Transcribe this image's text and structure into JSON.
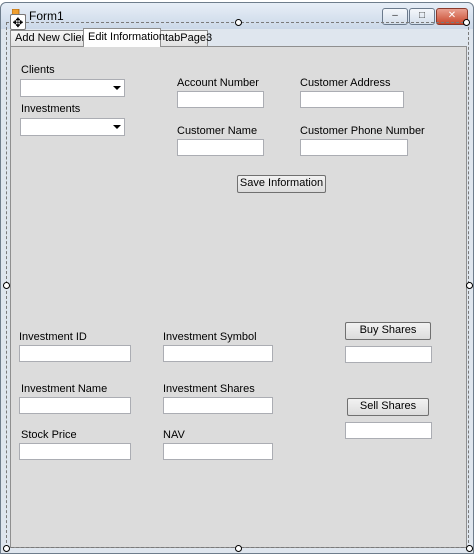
{
  "window": {
    "title": "Form1",
    "minimize_glyph": "–",
    "maximize_glyph": "□",
    "close_glyph": "✕"
  },
  "tabs": [
    {
      "label": "Add New Client"
    },
    {
      "label": "Edit Information"
    },
    {
      "label": "tabPage3"
    }
  ],
  "edit_info": {
    "clients_label": "Clients",
    "clients_value": "",
    "investments_label": "Investments",
    "investments_value": "",
    "account_number_label": "Account Number",
    "account_number_value": "",
    "customer_address_label": "Customer Address",
    "customer_address_value": "",
    "customer_name_label": "Customer Name",
    "customer_name_value": "",
    "customer_phone_label": "Customer Phone Number",
    "customer_phone_value": "",
    "save_button": "Save Information",
    "investment_id_label": "Investment ID",
    "investment_id_value": "",
    "investment_symbol_label": "Investment Symbol",
    "investment_symbol_value": "",
    "investment_name_label": "Investment Name",
    "investment_name_value": "",
    "investment_shares_label": "Investment Shares",
    "investment_shares_value": "",
    "stock_price_label": "Stock Price",
    "stock_price_value": "",
    "nav_label": "NAV",
    "nav_value": "",
    "buy_button": "Buy Shares",
    "buy_quantity_value": "",
    "sell_button": "Sell Shares",
    "sell_quantity_value": ""
  },
  "icons": {
    "app": "form-icon",
    "move": "move-handle-icon"
  }
}
